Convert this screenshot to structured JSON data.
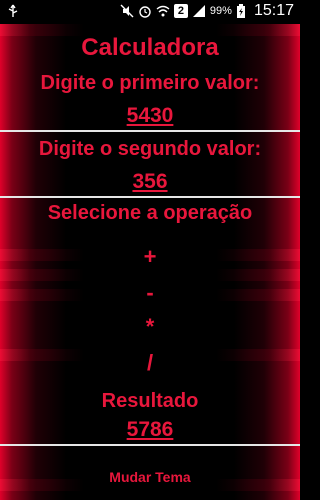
{
  "status_bar": {
    "time": "15:17",
    "battery_percent": "99%",
    "sim_badge": "2",
    "icons": [
      "usb-icon",
      "mute-icon",
      "alarm-icon",
      "wifi-icon",
      "sim-icon",
      "signal-icon",
      "battery-icon"
    ]
  },
  "app": {
    "title": "Calculadora",
    "first_label": "Digite o primeiro valor:",
    "first_value": "5430",
    "second_label": "Digite o segundo valor:",
    "second_value": "356",
    "operation_label": "Selecione a operação",
    "operations": [
      "+",
      "-",
      "*",
      "/"
    ],
    "result_label": "Resultado",
    "result_value": "5786",
    "theme_button": "Mudar Tema"
  },
  "colors": {
    "accent": "#e8173c",
    "background": "#000000",
    "side_glow": "#e0002a"
  }
}
